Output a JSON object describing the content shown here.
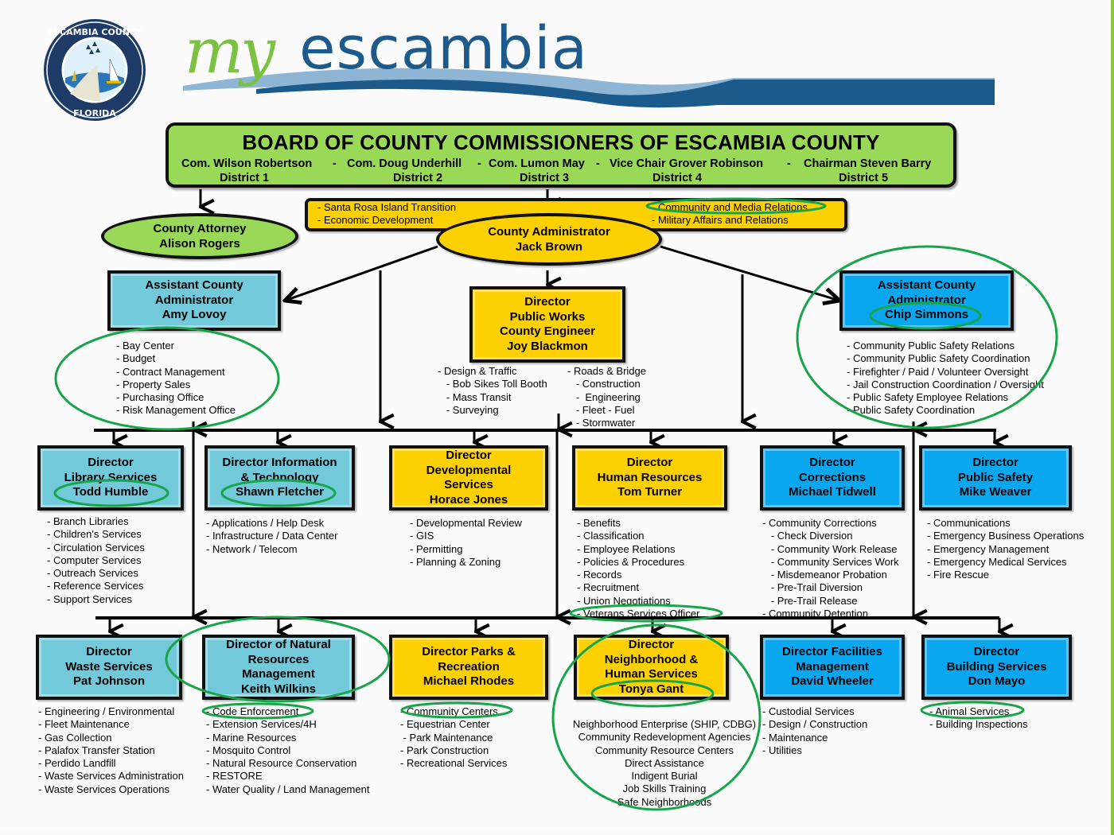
{
  "header": {
    "seal": {
      "top_text": "ESCAMBIA COUNTY",
      "bottom_text": "FLORIDA"
    },
    "logo": {
      "script_part": "my",
      "main_part": "escambia"
    }
  },
  "board": {
    "title": "BOARD OF COUNTY COMMISSIONERS OF ESCAMBIA COUNTY",
    "members": [
      {
        "name": "Com. Wilson Robertson",
        "district": "District 1"
      },
      {
        "name": "Com. Doug Underhill",
        "district": "District 2"
      },
      {
        "name": "Com. Lumon May",
        "district": "District 3"
      },
      {
        "name": "Vice Chair Grover Robinson",
        "district": "District 4"
      },
      {
        "name": "Chairman Steven Barry",
        "district": "District 5"
      }
    ],
    "separator": "-"
  },
  "county_attorney": {
    "title": "County Attorney",
    "name": "Alison Rogers"
  },
  "county_administrator": {
    "title": "County Administrator",
    "name": "Jack Brown",
    "responsibilities_left": [
      "- Santa Rosa Island Transition",
      "- Economic Development"
    ],
    "responsibilities_right": [
      "Community and Media Relations",
      "- Military Affairs and Relations"
    ]
  },
  "tier2": {
    "asst_admin_left": {
      "lines": [
        "Assistant County",
        "Administrator",
        "Amy Lovoy"
      ],
      "items": [
        "- Bay Center",
        "- Budget",
        "- Contract Management",
        "- Property Sales",
        "- Purchasing Office",
        "- Risk Management Office"
      ]
    },
    "public_works": {
      "lines": [
        "Director",
        "Public Works",
        "County Engineer",
        "Joy Blackmon"
      ],
      "items_left": [
        "- Design & Traffic",
        "   - Bob Sikes Toll Booth",
        "   - Mass Transit",
        "   - Surveying"
      ],
      "items_right": [
        "- Roads & Bridge",
        "   - Construction",
        "   -  Engineering",
        "   - Fleet - Fuel",
        "   - Stormwater"
      ]
    },
    "asst_admin_right": {
      "lines": [
        "Assistant County",
        "Administrator",
        "Chip Simmons"
      ],
      "items": [
        "- Community Public Safety Relations",
        "- Community Public Safety Coordination",
        "- Firefighter / Paid / Volunteer Oversight",
        "- Jail Construction Coordination / Oversight",
        "- Public Safety Employee Relations",
        "- Public Safety Coordination"
      ]
    }
  },
  "tier3": [
    {
      "lines": [
        "Director",
        "Library Services",
        "Todd Humble"
      ],
      "color": "teal",
      "items": [
        "- Branch Libraries",
        "- Children's Services",
        "- Circulation Services",
        "- Computer Services",
        "- Outreach Services",
        "- Reference Services",
        "- Support Services"
      ]
    },
    {
      "lines": [
        "Director Information",
        "& Technology",
        "Shawn  Fletcher"
      ],
      "color": "teal",
      "items": [
        "- Applications / Help Desk",
        "- Infrastructure / Data Center",
        "- Network / Telecom"
      ]
    },
    {
      "lines": [
        "Director",
        "Developmental",
        "Services",
        "Horace Jones"
      ],
      "color": "yellow",
      "items": [
        "- Developmental Review",
        "- GIS",
        "- Permitting",
        "- Planning & Zoning"
      ]
    },
    {
      "lines": [
        "Director",
        "Human Resources",
        "Tom Turner"
      ],
      "color": "yellow",
      "items": [
        "- Benefits",
        "- Classification",
        "- Employee Relations",
        "- Policies & Procedures",
        "- Records",
        "- Recruitment",
        "- Union Negotiations",
        "- Veterans Services Officer"
      ]
    },
    {
      "lines": [
        "Director",
        "Corrections",
        "Michael Tidwell"
      ],
      "color": "blue",
      "items": [
        "- Community Corrections",
        "   - Check Diversion",
        "   - Community Work Release",
        "   - Community Services Work",
        "   - Misdemeanor Probation",
        "   - Pre-Trail Diversion",
        "   - Pre-Trail Release",
        "- Community Detention"
      ]
    },
    {
      "lines": [
        "Director",
        "Public Safety",
        "Mike Weaver"
      ],
      "color": "blue",
      "items": [
        "- Communications",
        "- Emergency Business Operations",
        "- Emergency Management",
        "- Emergency Medical Services",
        "- Fire Rescue"
      ]
    }
  ],
  "tier4": [
    {
      "lines": [
        "Director",
        "Waste Services",
        "Pat Johnson"
      ],
      "color": "teal",
      "items": [
        "- Engineering / Environmental",
        "- Fleet Maintenance",
        "- Gas Collection",
        "- Palafox Transfer Station",
        "- Perdido Landfill",
        "- Waste Services Administration",
        "- Waste Services Operations"
      ]
    },
    {
      "lines": [
        "Director of Natural",
        "Resources",
        "Management",
        "Keith Wilkins"
      ],
      "color": "teal",
      "items": [
        "- Code Enforcement",
        "- Extension Services/4H",
        "- Marine Resources",
        "- Mosquito Control",
        "- Natural Resource Conservation",
        "- RESTORE",
        "- Water Quality / Land Management"
      ]
    },
    {
      "lines": [
        "Director Parks &",
        "Recreation",
        "Michael Rhodes"
      ],
      "color": "yellow",
      "items": [
        "- Community Centers",
        "- Equestrian Center",
        " - Park Maintenance",
        "- Park Construction",
        "- Recreational Services"
      ]
    },
    {
      "lines": [
        "Director",
        "Neighborhood &",
        "Human Services",
        "Tonya Gant"
      ],
      "color": "yellow",
      "items": [
        "Neighborhood Enterprise (SHIP, CDBG)",
        "Community Redevelopment Agencies",
        "Community Resource Centers",
        "Direct Assistance",
        "Indigent Burial",
        "Job Skills Training",
        "Safe Neighborhoods"
      ]
    },
    {
      "lines": [
        "Director Facilities",
        "Management",
        "David Wheeler"
      ],
      "color": "blue",
      "items": [
        "- Custodial Services",
        "- Design / Construction",
        "- Maintenance",
        "- Utilities"
      ]
    },
    {
      "lines": [
        "Director",
        "Building Services",
        "Don Mayo"
      ],
      "color": "blue",
      "items": [
        "- Animal Services",
        "- Building Inspections"
      ]
    }
  ],
  "colors": {
    "teal": "#71c9da",
    "blue": "#08a7ef",
    "yellow": "#fdd000",
    "green": "#9ad858",
    "highlight_ring": "#17a54a",
    "frame_accent": "#8cc63f",
    "logo_green": "#7cc242",
    "logo_blue": "#1d5a8c"
  }
}
